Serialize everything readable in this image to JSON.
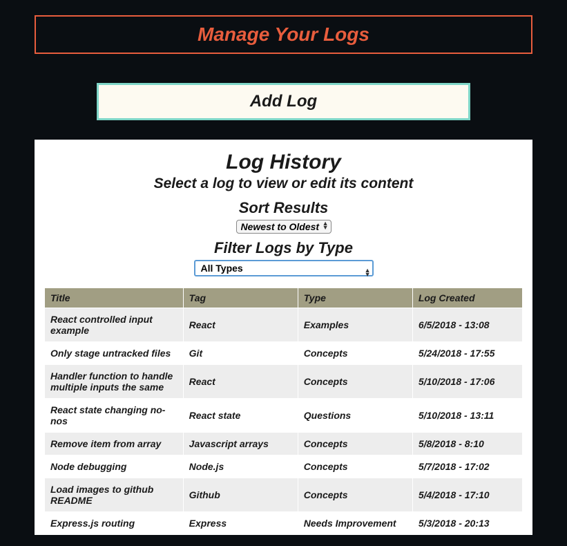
{
  "header": {
    "page_title": "Manage Your Logs",
    "add_log_label": "Add Log"
  },
  "history": {
    "title": "Log History",
    "subtitle": "Select a log to view or edit its content",
    "sort_label": "Sort Results",
    "sort_selected": "Newest to Oldest",
    "filter_label": "Filter Logs by Type",
    "filter_selected": "All Types",
    "columns": {
      "title": "Title",
      "tag": "Tag",
      "type": "Type",
      "created": "Log Created"
    },
    "rows": [
      {
        "title": "React controlled input example",
        "tag": "React",
        "type": "Examples",
        "created": "6/5/2018 - 13:08"
      },
      {
        "title": "Only stage untracked files",
        "tag": "Git",
        "type": "Concepts",
        "created": "5/24/2018 - 17:55"
      },
      {
        "title": "Handler function to handle multiple inputs the same",
        "tag": "React",
        "type": "Concepts",
        "created": "5/10/2018 - 17:06"
      },
      {
        "title": "React state changing no-nos",
        "tag": "React state",
        "type": "Questions",
        "created": "5/10/2018 - 13:11"
      },
      {
        "title": "Remove item from array",
        "tag": "Javascript arrays",
        "type": "Concepts",
        "created": "5/8/2018 - 8:10"
      },
      {
        "title": "Node debugging",
        "tag": "Node.js",
        "type": "Concepts",
        "created": "5/7/2018 - 17:02"
      },
      {
        "title": "Load images to github README",
        "tag": "Github",
        "type": "Concepts",
        "created": "5/4/2018 - 17:10"
      },
      {
        "title": "Express.js routing",
        "tag": "Express",
        "type": "Needs Improvement",
        "created": "5/3/2018 - 20:13"
      }
    ]
  }
}
